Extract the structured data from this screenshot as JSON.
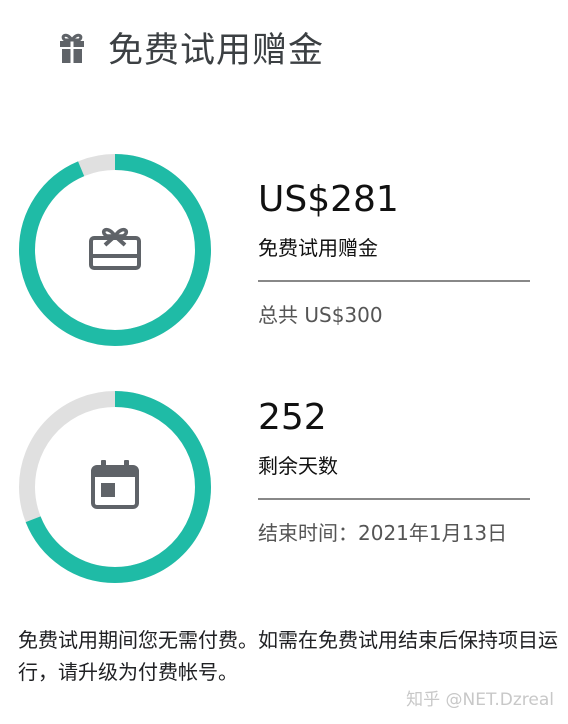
{
  "header": {
    "icon": "gift-icon",
    "title": "免费试用赠金"
  },
  "credit": {
    "amount": "US$281",
    "label": "免费试用赠金",
    "total": "总共 US$300",
    "used_fraction": 0.0633,
    "icon": "gift-card-icon"
  },
  "days": {
    "count": "252",
    "label": "剩余天数",
    "end_date": "结束时间：2021年1月13日",
    "remaining_fraction": 0.69,
    "icon": "calendar-icon"
  },
  "footer": {
    "text": "免费试用期间您无需付费。如需在免费试用结束后保持项目运行，请升级为付费帐号。"
  },
  "watermark": "知乎 @NET.Dzreal",
  "colors": {
    "accent": "#1fbba6",
    "track": "#e0e0e0",
    "icon": "#5f6368"
  }
}
